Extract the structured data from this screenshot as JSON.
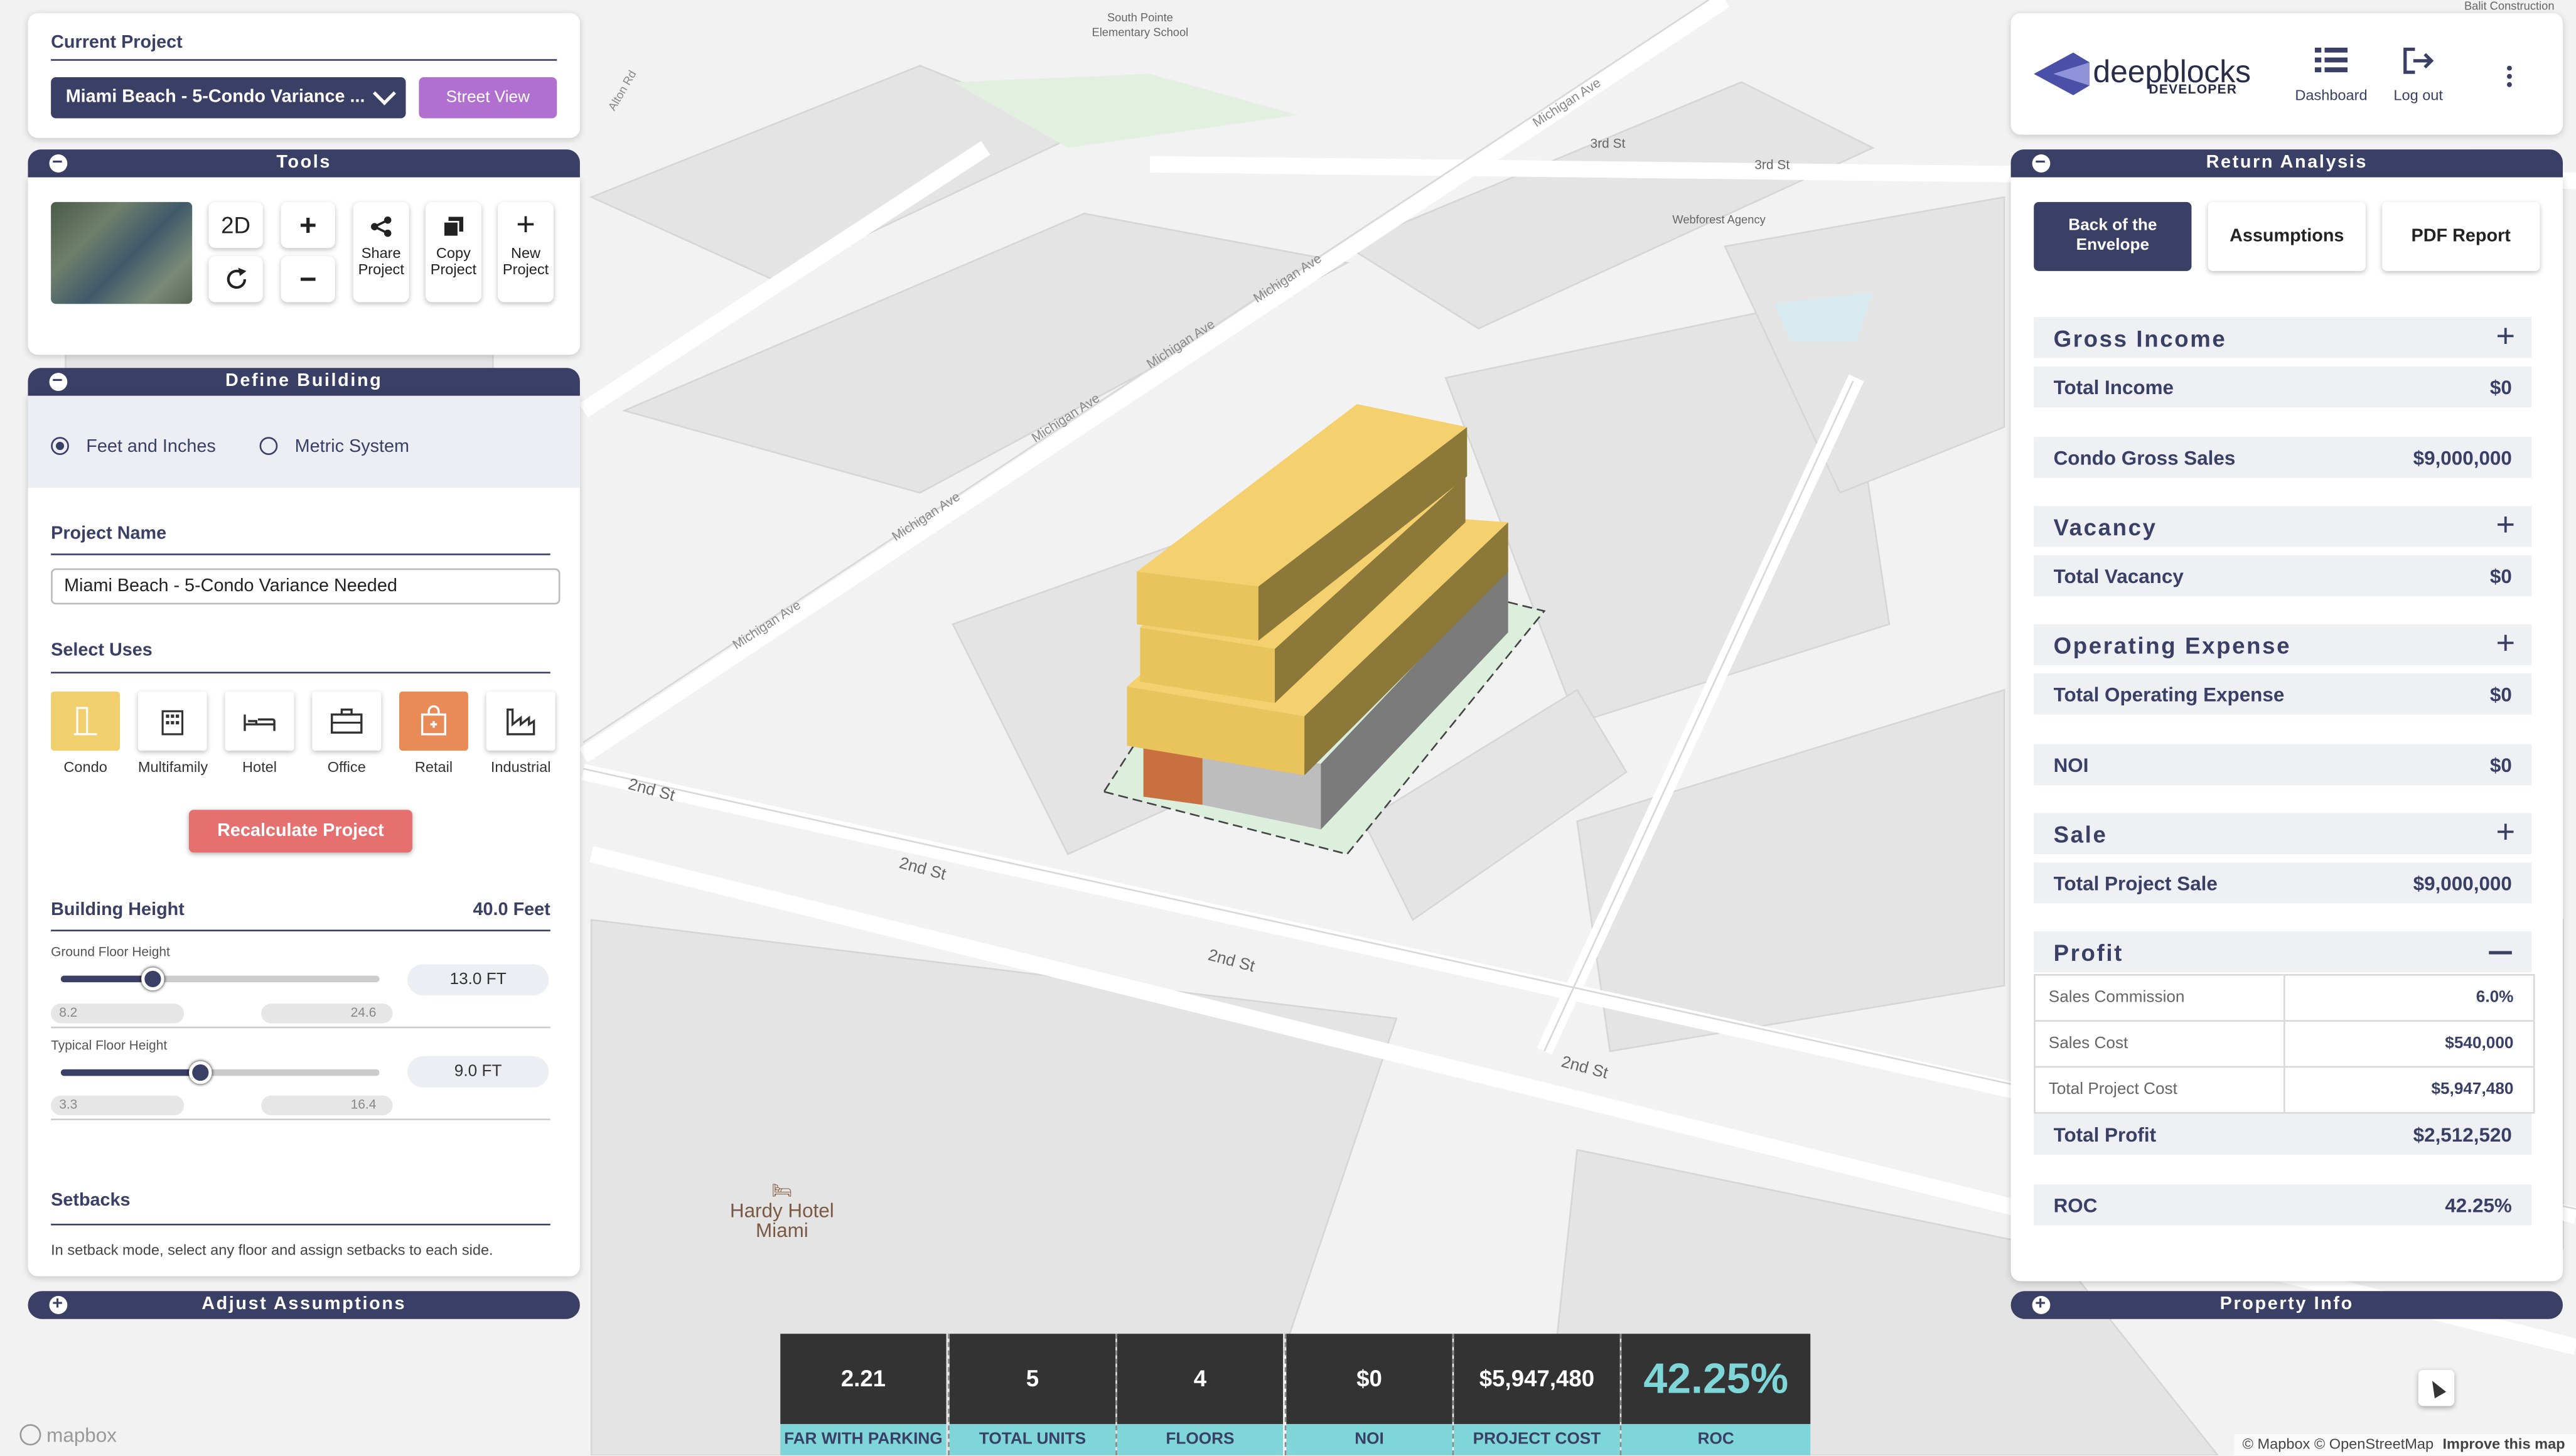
{
  "map": {
    "labels": {
      "school": "South Pointe Elementary School",
      "webforest": "Webforest Agency",
      "hotel": "Hardy Hotel Miami",
      "michigan": "Michigan Ave",
      "second": "2nd St",
      "third": "3rd St",
      "alton": "Alton Rd",
      "balit": "Balit Construction"
    },
    "attribution": "© Mapbox © OpenStreetMap",
    "improve": "Improve this map",
    "mapbox_logo": "mapbox"
  },
  "current_project": {
    "title": "Current Project",
    "selected": "Miami Beach - 5-Condo Variance ...",
    "street_view": "Street View"
  },
  "tools": {
    "title": "Tools",
    "btn_2d": "2D",
    "zoom_in": "+",
    "zoom_out": "−",
    "share": "Share Project",
    "copy": "Copy Project",
    "new": "New Project"
  },
  "define_building": {
    "title": "Define Building",
    "units_imperial": "Feet and Inches",
    "units_metric": "Metric System",
    "project_name_label": "Project Name",
    "project_name_value": "Miami Beach - 5-Condo Variance Needed",
    "select_uses_label": "Select Uses",
    "uses": [
      "Condo",
      "Multifamily",
      "Hotel",
      "Office",
      "Retail",
      "Industrial"
    ],
    "recalculate": "Recalculate Project",
    "building_height_label": "Building Height",
    "building_height_value": "40.0 Feet",
    "ground_floor_label": "Ground Floor Height",
    "ground_floor_value": "13.0 FT",
    "ground_min": "8.2",
    "ground_max": "24.6",
    "ground_fraction": 0.29,
    "typical_floor_label": "Typical Floor Height",
    "typical_floor_value": "9.0 FT",
    "typical_min": "3.3",
    "typical_max": "16.4",
    "typical_fraction": 0.44,
    "setbacks_label": "Setbacks",
    "setbacks_text": "In setback mode, select any floor and assign setbacks to each side."
  },
  "adjust_assumptions": "Adjust Assumptions",
  "property_info": "Property Info",
  "brand": {
    "name": "deepblocks",
    "sub": "DEVELOPER",
    "dashboard": "Dashboard",
    "logout": "Log out"
  },
  "return_analysis": {
    "title": "Return Analysis",
    "tabs": [
      "Back of the Envelope",
      "Assumptions",
      "PDF Report"
    ],
    "gross_income": "Gross Income",
    "total_income_label": "Total Income",
    "total_income": "$0",
    "condo_gross_label": "Condo Gross Sales",
    "condo_gross": "$9,000,000",
    "vacancy": "Vacancy",
    "total_vacancy_label": "Total Vacancy",
    "total_vacancy": "$0",
    "operating_expense": "Operating Expense",
    "total_opex_label": "Total Operating Expense",
    "total_opex": "$0",
    "noi_label": "NOI",
    "noi": "$0",
    "sale": "Sale",
    "total_sale_label": "Total Project Sale",
    "total_sale": "$9,000,000",
    "profit": "Profit",
    "profit_rows": [
      {
        "label": "Sales Commission",
        "value": "6.0%"
      },
      {
        "label": "Sales Cost",
        "value": "$540,000"
      },
      {
        "label": "Total Project Cost",
        "value": "$5,947,480"
      }
    ],
    "total_profit_label": "Total Profit",
    "total_profit": "$2,512,520",
    "roc_label": "ROC",
    "roc": "42.25%"
  },
  "stats": [
    {
      "value": "2.21",
      "caption": "FAR WITH PARKING"
    },
    {
      "value": "5",
      "caption": "TOTAL UNITS"
    },
    {
      "value": "4",
      "caption": "FLOORS"
    },
    {
      "value": "$0",
      "caption": "NOI"
    },
    {
      "value": "$5,947,480",
      "caption": "PROJECT COST"
    },
    {
      "value": "42.25%",
      "caption": "ROC"
    }
  ],
  "colors": {
    "navy": "#3a3f66",
    "purple": "#b16fd0",
    "condo": "#f1cf6c",
    "retail": "#e98b57",
    "recalc": "#e67070",
    "teal": "#7ed6d8"
  }
}
